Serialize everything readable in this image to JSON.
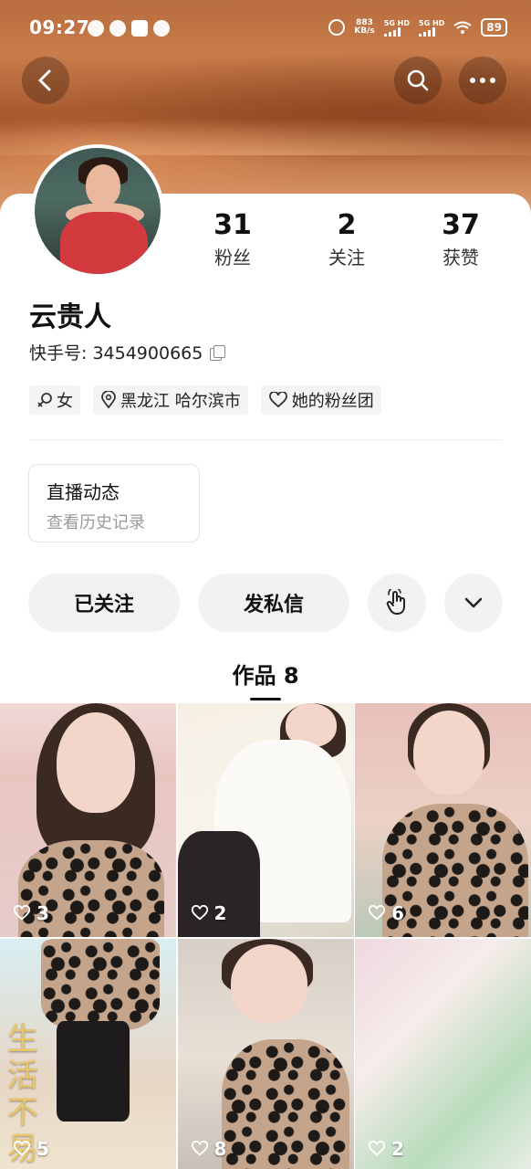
{
  "status_bar": {
    "time": "09:27",
    "net_speed": "883",
    "net_unit": "KB/s",
    "sim1": "5G HD",
    "sim2": "5G HD",
    "battery": "89"
  },
  "profile": {
    "name": "云贵人",
    "user_id_label": "快手号: ",
    "user_id": "3454900665",
    "stats": [
      {
        "value": "31",
        "label": "粉丝"
      },
      {
        "value": "2",
        "label": "关注"
      },
      {
        "value": "37",
        "label": "获赞"
      }
    ],
    "tags": [
      {
        "icon": "female-icon",
        "text": "女"
      },
      {
        "icon": "location-icon",
        "text": "黑龙江 哈尔滨市"
      },
      {
        "icon": "heart-outline-icon",
        "text": "她的粉丝团"
      }
    ]
  },
  "live": {
    "title": "直播动态",
    "subtitle": "查看历史记录"
  },
  "actions": {
    "follow_label": "已关注",
    "message_label": "发私信"
  },
  "works": {
    "tab_label": "作品 8",
    "items": [
      {
        "likes": "3"
      },
      {
        "likes": "2"
      },
      {
        "likes": "6"
      },
      {
        "likes": "5"
      },
      {
        "likes": "8"
      },
      {
        "likes": "2"
      }
    ],
    "overlay_text": "生活不易"
  },
  "colors": {
    "header_accent": "#b86d3f",
    "button_bg": "#f2f2f2"
  }
}
